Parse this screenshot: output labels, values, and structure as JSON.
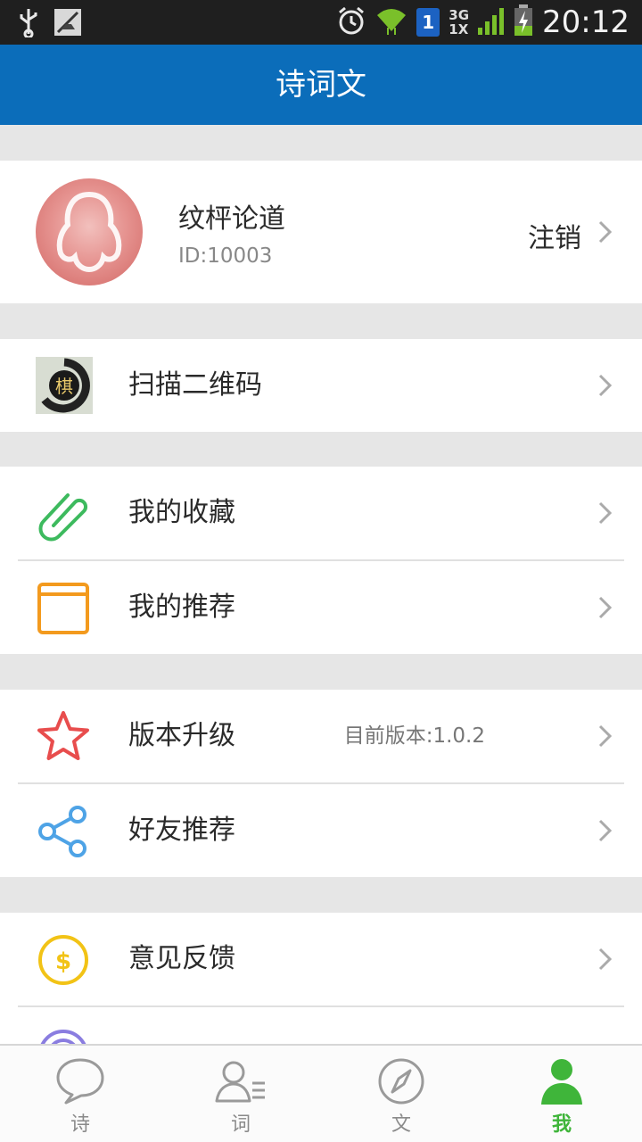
{
  "status_bar": {
    "time": "20:12",
    "sim_slot": "1",
    "network_top": "3G",
    "network_bottom": "1X"
  },
  "app_bar": {
    "title": "诗词文"
  },
  "profile": {
    "name": "纹枰论道",
    "id_text": "ID:10003",
    "logout_label": "注销"
  },
  "menu": {
    "scan": {
      "label": "扫描二维码",
      "icon_char": "棋"
    },
    "favorites": {
      "label": "我的收藏"
    },
    "recommendations": {
      "label": "我的推荐"
    },
    "upgrade": {
      "label": "版本升级",
      "value": "目前版本:1.0.2"
    },
    "share": {
      "label": "好友推荐"
    },
    "feedback": {
      "label": "意见反馈"
    }
  },
  "bottom_nav": {
    "items": [
      {
        "label": "诗",
        "active": false
      },
      {
        "label": "词",
        "active": false
      },
      {
        "label": "文",
        "active": false
      },
      {
        "label": "我",
        "active": true
      }
    ]
  },
  "colors": {
    "app_bar": "#0b6dba",
    "active_tab": "#3fb53a",
    "favorites_icon": "#3dba5e",
    "recommend_icon": "#f39a1e",
    "upgrade_icon": "#e84d4d",
    "share_icon": "#4ea3e6",
    "feedback_icon": "#f2c316"
  }
}
